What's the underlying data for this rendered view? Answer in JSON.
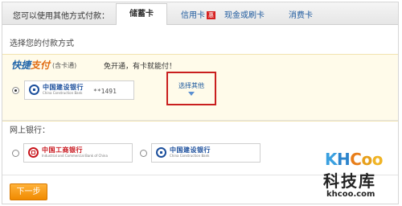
{
  "tabs": {
    "prompt": "您可以使用其他方式付款：",
    "items": [
      {
        "label": "储蓄卡",
        "active": true
      },
      {
        "label": "信用卡",
        "badge": "惠"
      },
      {
        "label": "现金或刷卡"
      },
      {
        "label": "消费卡"
      }
    ]
  },
  "quick_pay": {
    "section_title": "选择您的付款方式",
    "logo_part1": "快捷",
    "logo_part2": "支付",
    "logo_note": "(含卡通)",
    "description": "免开通，有卡就能付！",
    "selected_bank": {
      "name_cn": "中国建设银行",
      "name_en": "China Construction Bank",
      "card_mask": "**1491"
    },
    "choose_other": "选择其他"
  },
  "online_banking": {
    "section_title": "网上银行：",
    "banks": [
      {
        "name_cn": "中国工商银行",
        "name_en": "Industrial and Commercial Bank of China"
      },
      {
        "name_cn": "中国建设银行",
        "name_en": "China Construction Bank"
      }
    ]
  },
  "next_button": "下一步",
  "watermark": {
    "brand": [
      "K",
      "H",
      "C",
      "o",
      "o"
    ],
    "cn": "科技库",
    "url": "khcoo.com"
  },
  "colors": {
    "accent_orange": "#f08a00",
    "highlight_border": "#c91f1f",
    "link_blue": "#1e5a9e",
    "quick_bg": "#fffbea"
  }
}
